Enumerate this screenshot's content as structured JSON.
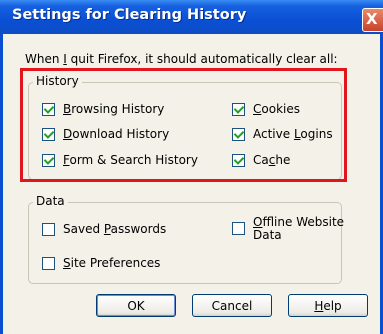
{
  "window": {
    "title": "Settings for Clearing History",
    "close_glyph": "X"
  },
  "prompt": {
    "before": "When ",
    "accel": "I",
    "after": " quit Firefox, it should automatically clear all:"
  },
  "history_group": {
    "label": "History",
    "items": [
      {
        "accel": "B",
        "rest": "rowsing History",
        "checked": true
      },
      {
        "accel": "D",
        "rest": "ownload History",
        "checked": true
      },
      {
        "accel": "F",
        "rest": "orm & Search History",
        "checked": true
      },
      {
        "accel": "C",
        "rest": "ookies",
        "checked": true
      },
      {
        "pre": "Active ",
        "accel": "L",
        "rest": "ogins",
        "checked": true
      },
      {
        "pre": "Ca",
        "accel": "c",
        "rest": "he",
        "checked": true
      }
    ]
  },
  "data_group": {
    "label": "Data",
    "items": [
      {
        "pre": "Saved ",
        "accel": "P",
        "rest": "asswords",
        "checked": false
      },
      {
        "accel": "S",
        "rest": "ite Preferences",
        "checked": false
      },
      {
        "accel": "O",
        "rest": "ffline Website",
        "line2": "Data",
        "checked": false
      }
    ]
  },
  "buttons": {
    "ok": "OK",
    "cancel": "Cancel",
    "help_accel": "H",
    "help_rest": "elp"
  },
  "colors": {
    "highlight_box": "#e0161c",
    "titlebar": "#0a4fd4",
    "check": "#21a121"
  }
}
